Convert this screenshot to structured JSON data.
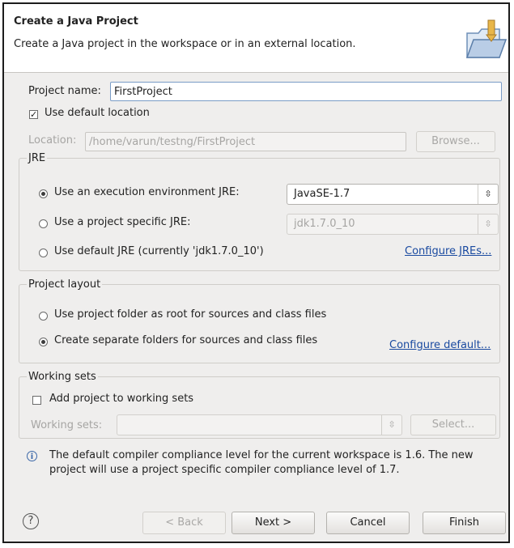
{
  "banner": {
    "title": "Create a Java Project",
    "description": "Create a Java project in the workspace or in an external location.",
    "icon": "new-java-project-folder-icon"
  },
  "project": {
    "name_label": "Project name:",
    "name_value": "FirstProject",
    "use_default_location_label": "Use default location",
    "use_default_location_checked": true,
    "location_label": "Location:",
    "location_value": "/home/varun/testng/FirstProject",
    "browse_label": "Browse..."
  },
  "jre": {
    "title": "JRE",
    "option_env_label": "Use an execution environment JRE:",
    "option_env_value": "JavaSE-1.7",
    "option_specific_label": "Use a project specific JRE:",
    "option_specific_value": "jdk1.7.0_10",
    "option_default_label": "Use default JRE (currently 'jdk1.7.0_10')",
    "configure_link": "Configure JREs..."
  },
  "layout": {
    "title": "Project layout",
    "option_root_label": "Use project folder as root for sources and class files",
    "option_separate_label": "Create separate folders for sources and class files",
    "configure_link": "Configure default..."
  },
  "working_sets": {
    "title": "Working sets",
    "add_label": "Add project to working sets",
    "sets_label": "Working sets:",
    "select_label": "Select..."
  },
  "info": {
    "line1": "The default compiler compliance level for the current workspace is 1.6. The new",
    "line2": "project will use a project specific compiler compliance level of 1.7."
  },
  "buttons": {
    "help": "?",
    "back": "< Back",
    "next": "Next >",
    "cancel": "Cancel",
    "finish": "Finish"
  }
}
